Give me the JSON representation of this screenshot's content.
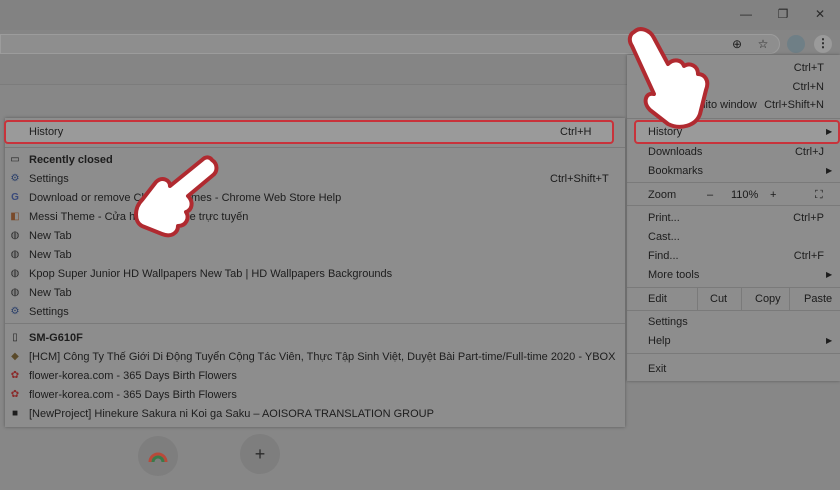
{
  "window": {
    "min": "—",
    "restore": "❐",
    "close": "✕"
  },
  "toolbar": {
    "zoom_icon": "⊕",
    "star_icon": "☆",
    "menu_icon": "⋮"
  },
  "menu": {
    "new_tab_shortcut": "Ctrl+T",
    "new_window_shortcut": "Ctrl+N",
    "new_incognito_label": "New incognito window",
    "new_incognito_shortcut": "Ctrl+Shift+N",
    "history_label": "History",
    "downloads_label": "Downloads",
    "downloads_shortcut": "Ctrl+J",
    "bookmarks_label": "Bookmarks",
    "zoom_label": "Zoom",
    "zoom_minus": "–",
    "zoom_value": "110%",
    "zoom_plus": "+",
    "print_label": "Print...",
    "print_shortcut": "Ctrl+P",
    "cast_label": "Cast...",
    "find_label": "Find...",
    "find_shortcut": "Ctrl+F",
    "more_tools_label": "More tools",
    "edit_label": "Edit",
    "cut_label": "Cut",
    "copy_label": "Copy",
    "paste_label": "Paste",
    "settings_label": "Settings",
    "help_label": "Help",
    "exit_label": "Exit"
  },
  "history_submenu": {
    "history_label": "History",
    "history_shortcut": "Ctrl+H",
    "recently_closed_label": "Recently closed",
    "items": [
      {
        "label": "Settings",
        "shortcut": "Ctrl+Shift+T",
        "icon": "gear-icon"
      },
      {
        "label": "Download or remove Chrome themes - Chrome Web Store Help",
        "icon": "google-icon"
      },
      {
        "label": "Messi Theme - Cửa hàng Chrome trực tuyến",
        "icon": "chrome-web-store-icon"
      },
      {
        "label": "New Tab",
        "icon": "globe-icon"
      },
      {
        "label": "New Tab",
        "icon": "globe-icon"
      },
      {
        "label": "Kpop Super Junior HD Wallpapers New Tab | HD Wallpapers  Backgrounds",
        "icon": "globe-icon"
      },
      {
        "label": "New Tab",
        "icon": "globe-icon"
      },
      {
        "label": "Settings",
        "icon": "gear-icon"
      }
    ],
    "device_label": "SM-G610F",
    "device_items": [
      {
        "label": "[HCM] Công Ty Thế Giới Di Động Tuyển Cộng Tác Viên, Thực Tập Sinh Việt, Duyệt Bài Part-time/Full-time 2020 - YBOX",
        "icon": "cube-icon"
      },
      {
        "label": "flower-korea.com - 365 Days Birth Flowers",
        "icon": "flower-icon"
      },
      {
        "label": "flower-korea.com - 365 Days Birth Flowers",
        "icon": "flower-icon"
      },
      {
        "label": "[NewProject] Hinekure Sakura ni Koi ga Saku – AOISORA TRANSLATION GROUP",
        "icon": "site-icon"
      }
    ]
  },
  "bottom": {
    "add_label": "+"
  }
}
